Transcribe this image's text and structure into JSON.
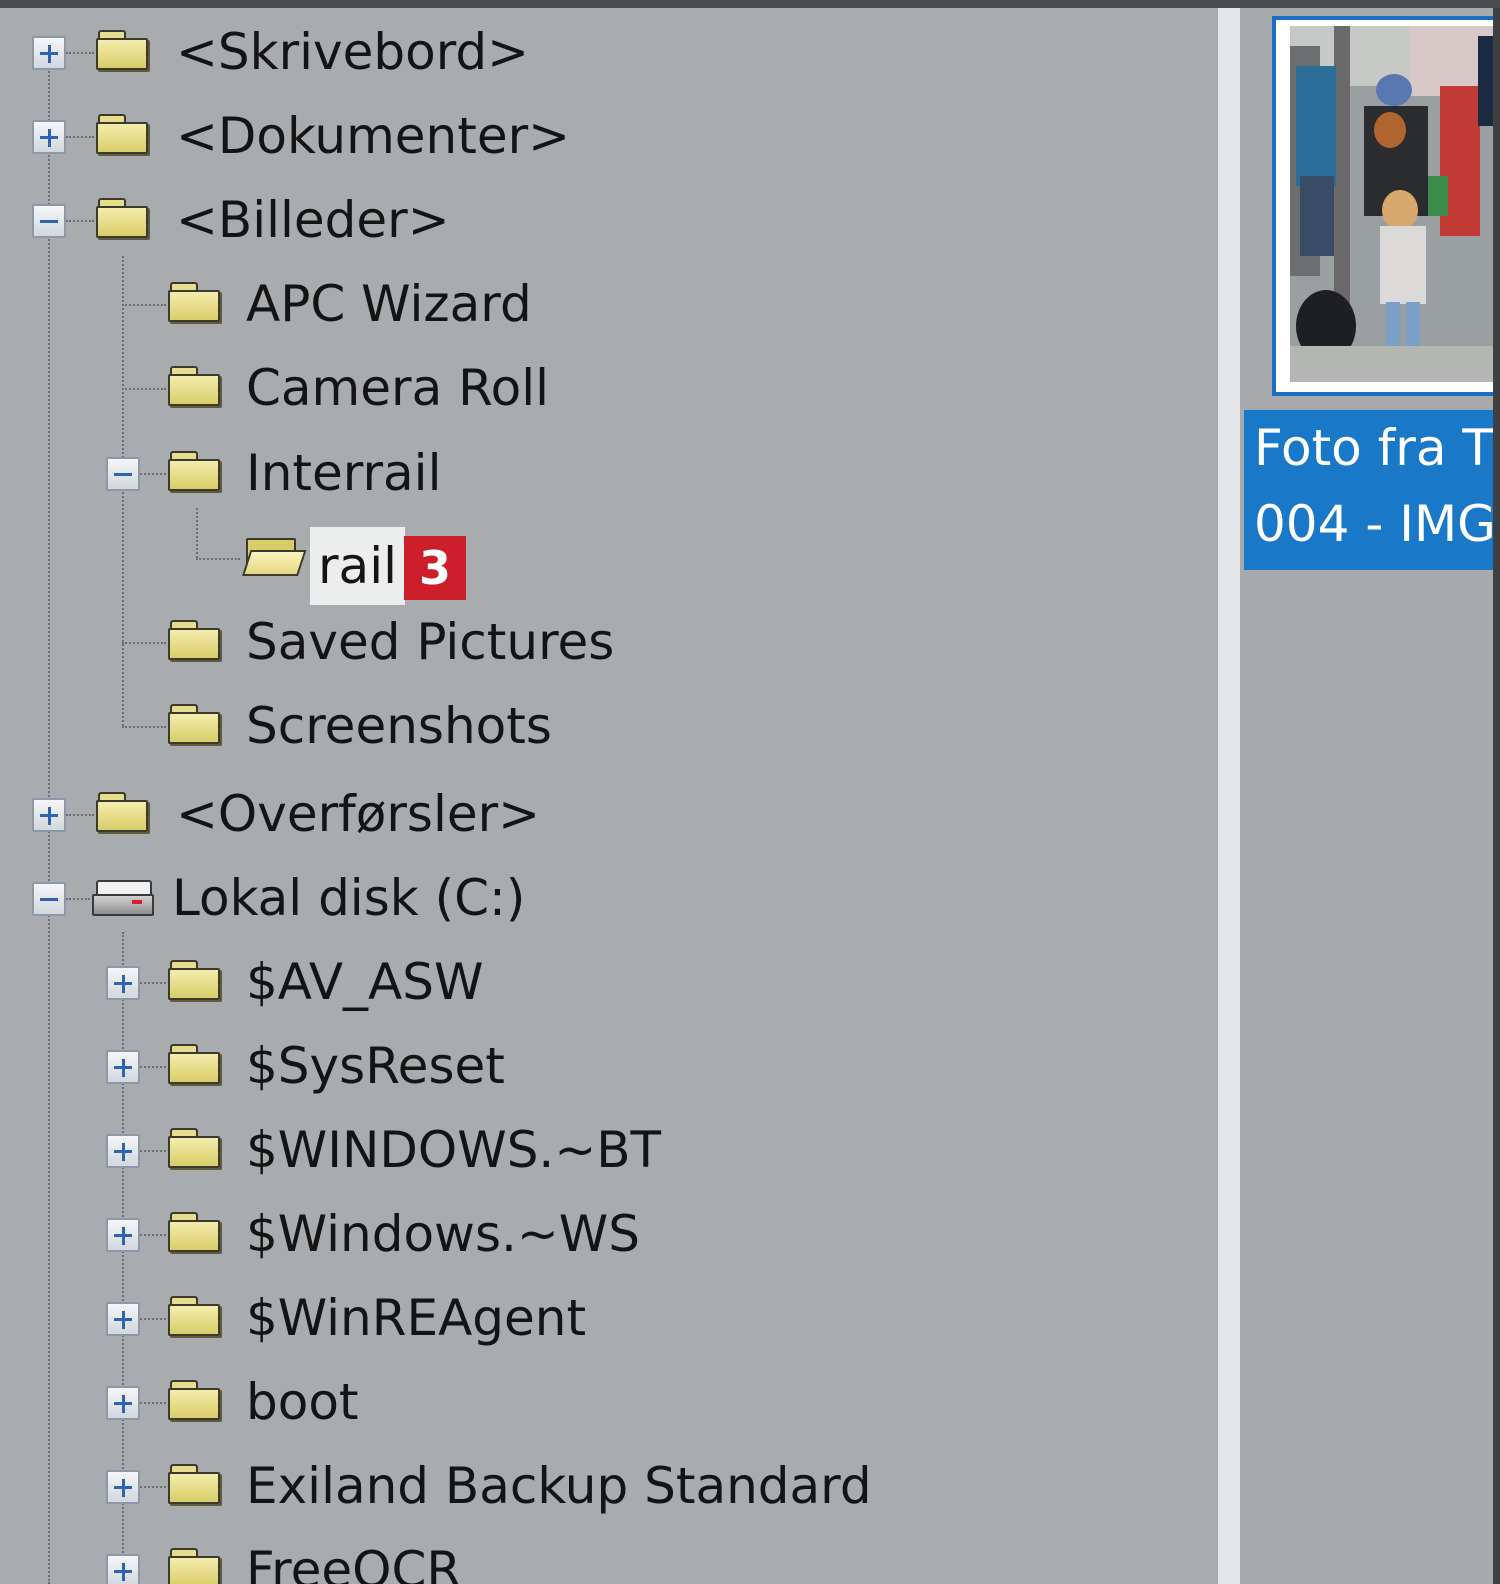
{
  "tree": {
    "desktop": "<Skrivebord>",
    "documents": "<Dokumenter>",
    "pictures": "<Billeder>",
    "pictures_children": [
      "APC Wizard",
      "Camera Roll",
      "Interrail",
      "Saved Pictures",
      "Screenshots"
    ],
    "interrail_child": "rail",
    "downloads": "<Overførsler>",
    "local_disk": "Lokal disk (C:)",
    "c_children": [
      "$AV_ASW",
      "$SysReset",
      "$WINDOWS.~BT",
      "$Windows.~WS",
      "$WinREAgent",
      "boot",
      "Exiland Backup Standard",
      "FreeOCR"
    ]
  },
  "annotation_badge": "3",
  "thumbnail": {
    "caption_line1": "Foto fra T",
    "caption_line2": "004 - IMG"
  },
  "colors": {
    "pane_background": "#a9acae",
    "selection_blue": "#1a78c8",
    "badge_red": "#cc1f2b",
    "folder_yellow": "#e8de86"
  },
  "icons": {
    "expander_collapsed": "plus-box-icon",
    "expander_expanded": "minus-box-icon",
    "folder": "folder-icon",
    "open_folder": "open-folder-icon",
    "drive": "hard-drive-icon"
  }
}
